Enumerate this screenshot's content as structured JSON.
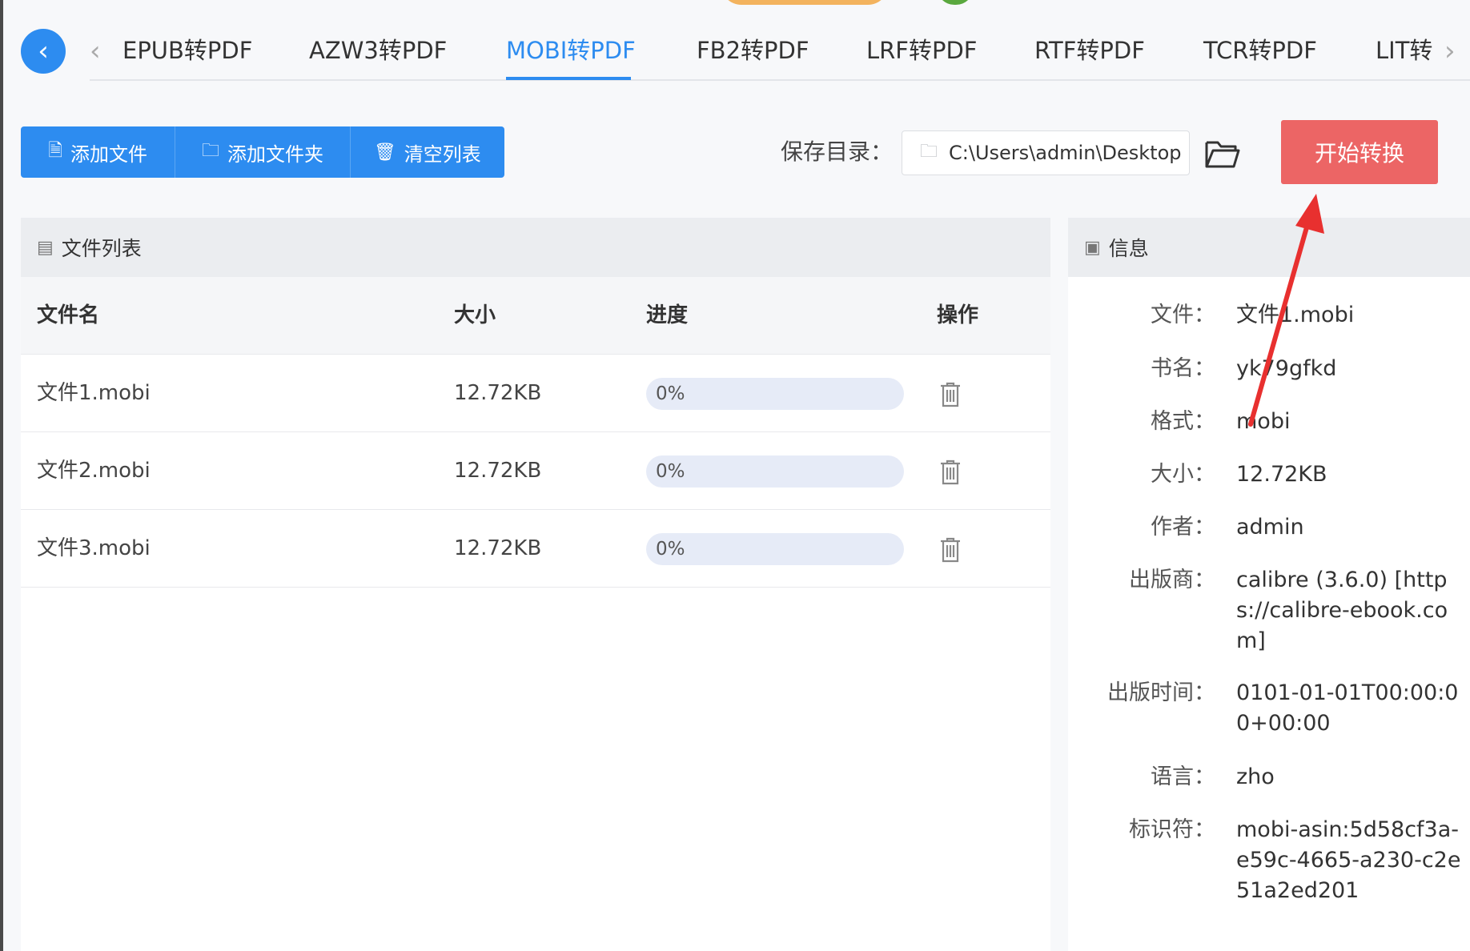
{
  "tabs": [
    {
      "label": "EPUB转PDF",
      "active": false
    },
    {
      "label": "AZW3转PDF",
      "active": false
    },
    {
      "label": "MOBI转PDF",
      "active": true
    },
    {
      "label": "FB2转PDF",
      "active": false
    },
    {
      "label": "LRF转PDF",
      "active": false
    },
    {
      "label": "RTF转PDF",
      "active": false
    },
    {
      "label": "TCR转PDF",
      "active": false
    },
    {
      "label": "LIT转",
      "active": false
    }
  ],
  "toolbar": {
    "add_file": "添加文件",
    "add_folder": "添加文件夹",
    "clear_list": "清空列表",
    "save_label": "保存目录：",
    "save_path": "C:\\Users\\admin\\Desktop",
    "start": "开始转换"
  },
  "file_list": {
    "title": "文件列表",
    "columns": [
      "文件名",
      "大小",
      "进度",
      "操作"
    ],
    "rows": [
      {
        "name": "文件1.mobi",
        "size": "12.72KB",
        "progress": "0%",
        "progress_value": 0
      },
      {
        "name": "文件2.mobi",
        "size": "12.72KB",
        "progress": "0%",
        "progress_value": 0
      },
      {
        "name": "文件3.mobi",
        "size": "12.72KB",
        "progress": "0%",
        "progress_value": 0
      }
    ]
  },
  "info": {
    "title": "信息",
    "fields": [
      {
        "key": "文件：",
        "value": "文件1.mobi"
      },
      {
        "key": "书名：",
        "value": "yk79gfkd"
      },
      {
        "key": "格式：",
        "value": "mobi"
      },
      {
        "key": "大小：",
        "value": "12.72KB"
      },
      {
        "key": "作者：",
        "value": "admin"
      },
      {
        "key": "出版商：",
        "value": "calibre (3.6.0) [https://calibre-ebook.com]"
      },
      {
        "key": "出版时间：",
        "value": "0101-01-01T00:00:00+00:00"
      },
      {
        "key": "语言：",
        "value": "zho"
      },
      {
        "key": "标识符：",
        "value": "mobi-asin:5d58cf3a-e59c-4665-a230-c2e51a2ed201"
      }
    ]
  },
  "colors": {
    "accent": "#2d8cf0",
    "start_button": "#ec6565",
    "annotation_arrow": "#e8302f"
  },
  "icons": {
    "back": "chevron-left-icon",
    "file": "file-icon",
    "folder": "folder-icon",
    "clear": "trash-icon",
    "browse": "folder-open-icon",
    "list": "list-icon",
    "info": "info-icon",
    "delete": "trash-icon"
  }
}
